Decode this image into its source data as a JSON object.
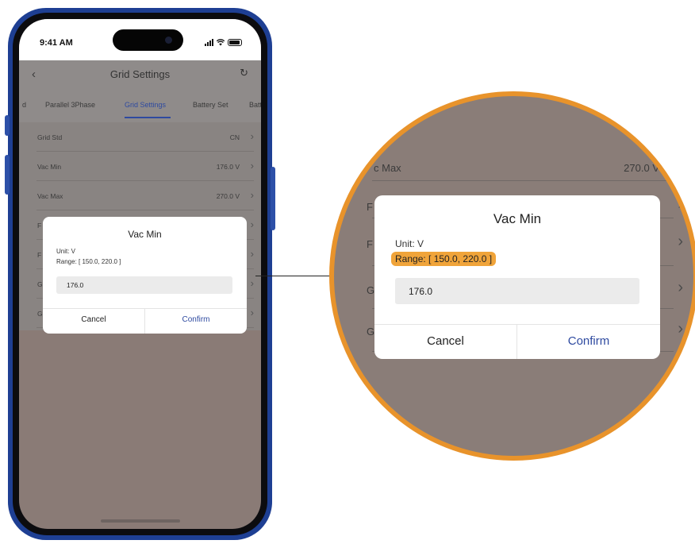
{
  "status_bar": {
    "time": "9:41 AM"
  },
  "nav": {
    "back_icon": "chevron-left",
    "title": "Grid Settings",
    "refresh_icon": "refresh"
  },
  "tabs": [
    {
      "label": "d",
      "active": false
    },
    {
      "label": "Parallel 3Phase",
      "active": false
    },
    {
      "label": "Grid Settings",
      "active": true
    },
    {
      "label": "Battery Set",
      "active": false
    },
    {
      "label": "Batt",
      "active": false
    }
  ],
  "settings": [
    {
      "label": "Grid Std",
      "value": "CN"
    },
    {
      "label": "Vac Min",
      "value": "176.0 V"
    },
    {
      "label": "Vac Max",
      "value": "270.0 V"
    },
    {
      "label": "F",
      "value": ""
    },
    {
      "label": "F",
      "value": ""
    },
    {
      "label": "G",
      "value": ""
    },
    {
      "label": "G",
      "value": ""
    }
  ],
  "dialog": {
    "title": "Vac Min",
    "unit": "Unit: V",
    "range": "Range: [ 150.0, 220.0 ]",
    "input_value": "176.0",
    "cancel": "Cancel",
    "confirm": "Confirm"
  },
  "magnifier": {
    "row_vac_max_label": "c Max",
    "row_vac_max_value": "270.0 V",
    "partial_labels": [
      "F",
      "F",
      "G",
      "G"
    ],
    "highlight_color": "#f0a43a",
    "ring_color": "#e8932b"
  },
  "colors": {
    "accent": "#2e4aa0",
    "phone_frame": "#1e3f93"
  }
}
